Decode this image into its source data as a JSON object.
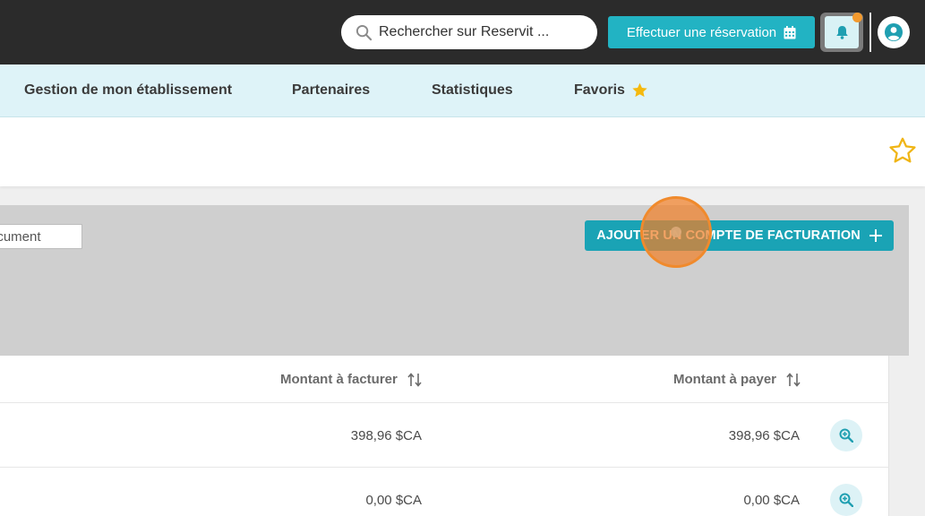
{
  "topbar": {
    "search_placeholder": "Rechercher sur Reservit ...",
    "reserve_label": "Effectuer une réservation",
    "icons": [
      "search-icon",
      "calendar-icon",
      "bell-icon",
      "user-icon"
    ],
    "colors": {
      "background": "#2b2b2b",
      "accent": "#22b3c3",
      "notification": "#f29a2e"
    }
  },
  "nav": {
    "items": [
      {
        "label": "Gestion de mon établissement"
      },
      {
        "label": "Partenaires"
      },
      {
        "label": "Statistiques"
      },
      {
        "label": "Favoris"
      }
    ],
    "favoris_icon": "star-filled-icon",
    "star_color": "#f5b90e"
  },
  "header": {
    "favorite_icon": "star-outline-icon"
  },
  "filters": {
    "document_placeholder": "Document",
    "document_visible_text": "ocument"
  },
  "actions": {
    "add_billing_account_label": "AJOUTER UN COMPTE DE FACTURATION",
    "add_icon": "plus-icon"
  },
  "table": {
    "columns": [
      {
        "label": "Montant à facturer",
        "sort_icon": "sort-icon"
      },
      {
        "label": "Montant à payer",
        "sort_icon": "sort-icon"
      }
    ],
    "rows": [
      {
        "amount_to_bill": "398,96 $CA",
        "amount_to_pay": "398,96 $CA",
        "action_icon": "zoom-in-icon"
      },
      {
        "amount_to_bill": "0,00 $CA",
        "amount_to_pay": "0,00 $CA",
        "action_icon": "zoom-in-icon"
      }
    ]
  }
}
